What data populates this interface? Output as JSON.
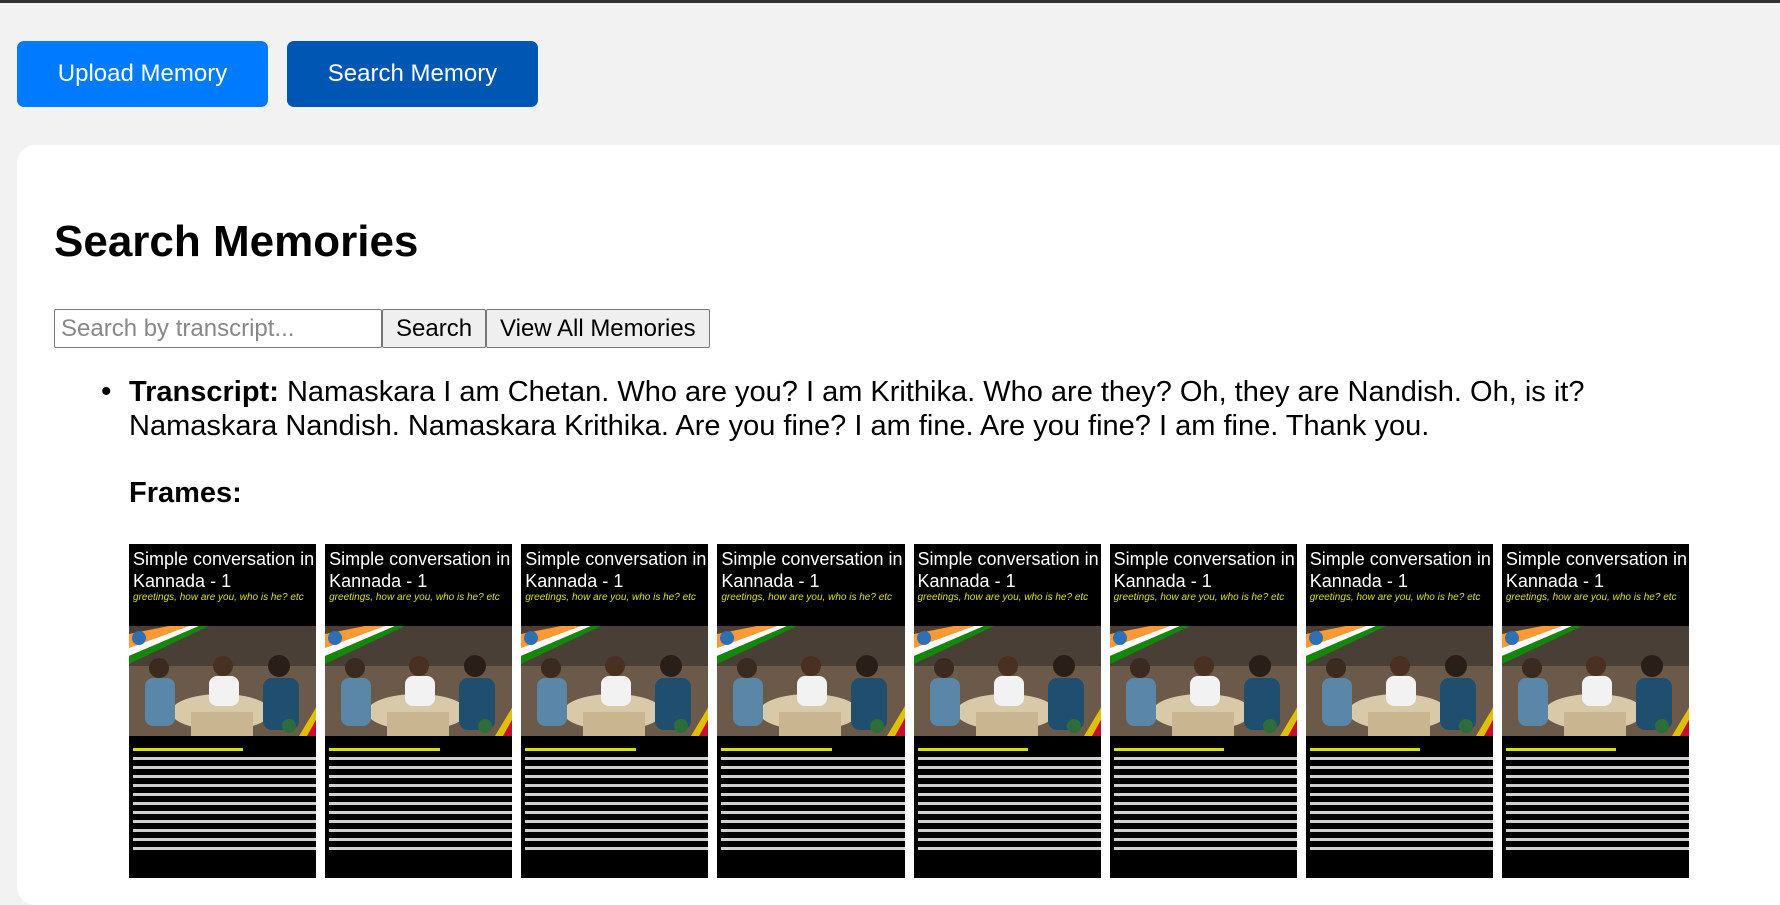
{
  "nav": {
    "upload_label": "Upload Memory",
    "search_label": "Search Memory"
  },
  "page": {
    "title": "Search Memories"
  },
  "search": {
    "placeholder": "Search by transcript...",
    "button_label": "Search",
    "view_all_label": "View All Memories"
  },
  "result": {
    "transcript_label": "Transcript:",
    "transcript_text": "Namaskara I am Chetan. Who are you? I am Krithika. Who are they? Oh, they are Nandish. Oh, is it? Namaskara Nandish. Namaskara Krithika. Are you fine? I am fine. Are you fine? I am fine. Thank you.",
    "frames_label": "Frames:",
    "frames": [
      {
        "title": "Simple conversation in Kannada - 1",
        "subtitle": "greetings, how are you, who is he? etc"
      },
      {
        "title": "Simple conversation in Kannada - 1",
        "subtitle": "greetings, how are you, who is he? etc"
      },
      {
        "title": "Simple conversation in Kannada - 1",
        "subtitle": "greetings, how are you, who is he? etc"
      },
      {
        "title": "Simple conversation in Kannada - 1",
        "subtitle": "greetings, how are you, who is he? etc"
      },
      {
        "title": "Simple conversation in Kannada - 1",
        "subtitle": "greetings, how are you, who is he? etc"
      },
      {
        "title": "Simple conversation in Kannada - 1",
        "subtitle": "greetings, how are you, who is he? etc"
      },
      {
        "title": "Simple conversation in Kannada - 1",
        "subtitle": "greetings, how are you, who is he? etc"
      },
      {
        "title": "Simple conversation in Kannada - 1",
        "subtitle": "greetings, how are you, who is he? etc"
      }
    ]
  },
  "colors": {
    "upload_button": "#007bff",
    "search_button": "#0056b3",
    "frame_subtitle": "#d9e000"
  }
}
